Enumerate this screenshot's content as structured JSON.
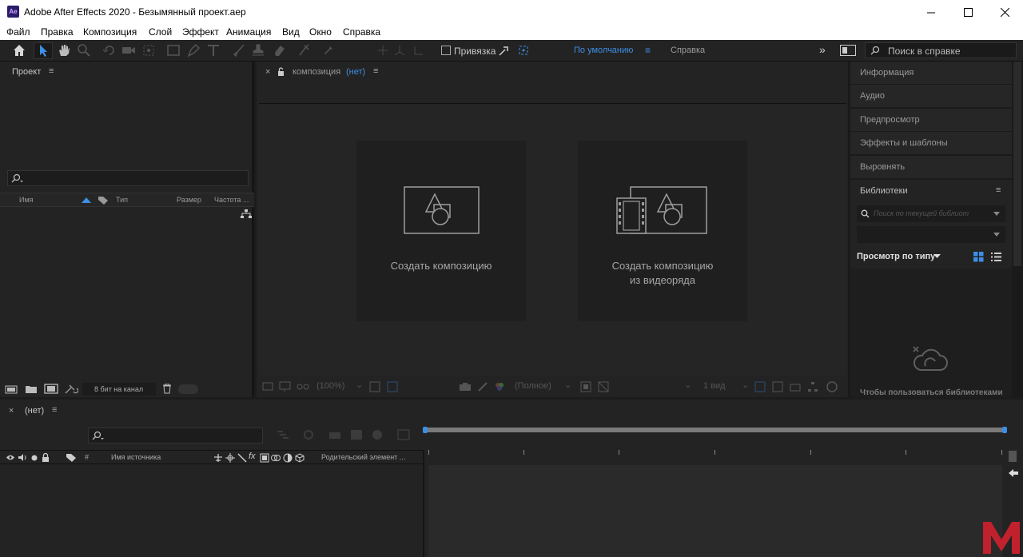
{
  "app": {
    "title": "Adobe After Effects 2020 - Безымянный проект.aep",
    "logo": "Ae"
  },
  "menu": [
    "Файл",
    "Правка",
    "Композиция",
    "Слой",
    "Эффект",
    "Анимация",
    "Вид",
    "Окно",
    "Справка"
  ],
  "toolbar": {
    "snap_label": "Привязка",
    "workspace_default": "По умолчанию",
    "workspace_help": "Справка",
    "search_placeholder": "Поиск в справке"
  },
  "project": {
    "tab": "Проект",
    "columns": [
      "Имя",
      "Тип",
      "Размер",
      "Частота ..."
    ],
    "bit_depth": "8 бит на канал"
  },
  "composition": {
    "tab_prefix": "композиция",
    "tab_value": "(нет)",
    "card1": "Создать композицию",
    "card2_line1": "Создать композицию",
    "card2_line2": "из видеоряда",
    "zoom": "(100%)",
    "resolution": "(Полное)",
    "views": "1 вид"
  },
  "right_panels": [
    "Информация",
    "Аудио",
    "Предпросмотр",
    "Эффекты и шаблоны",
    "Выровнять"
  ],
  "libraries": {
    "title": "Библиотеки",
    "search_placeholder": "Поиск по текущей библиот",
    "view_by": "Просмотр по типу",
    "message": "Чтобы пользоваться библиотеками"
  },
  "timeline": {
    "tab": "(нет)",
    "col_hash": "#",
    "col_source": "Имя источника",
    "col_parent": "Родительский элемент ..."
  },
  "colors": {
    "accent": "#2d8ceb",
    "bg": "#1c1c1c",
    "panel": "#232323"
  }
}
